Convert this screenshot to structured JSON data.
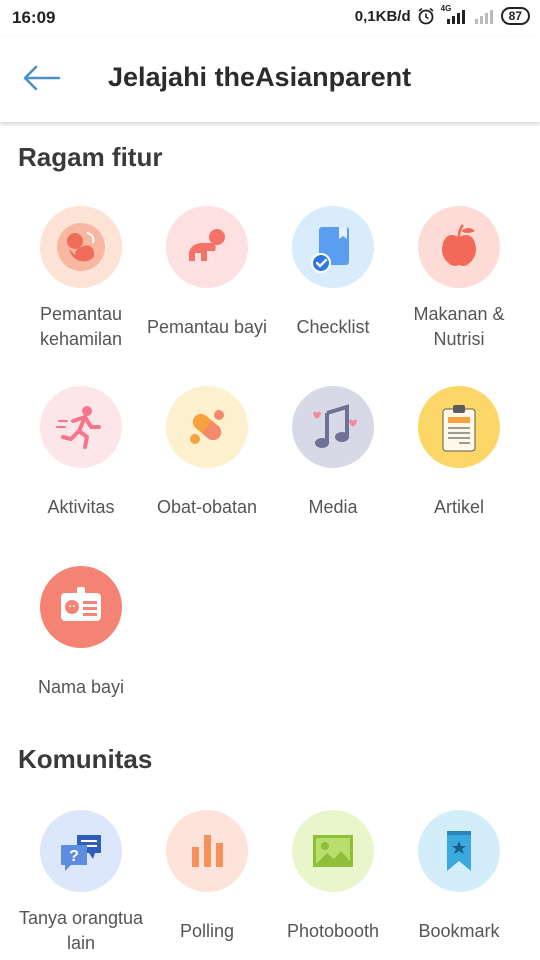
{
  "status_bar": {
    "time": "16:09",
    "network_speed": "0,1KB/d",
    "signal_label": "4G",
    "battery": "87"
  },
  "header": {
    "title": "Jelajahi theAsianparent"
  },
  "sections": {
    "features": {
      "title": "Ragam fitur",
      "items": [
        {
          "label": "Pemantau kehamilan",
          "icon": "pregnancy-icon",
          "color": "#FDE3D6"
        },
        {
          "label": "Pemantau bayi",
          "icon": "crawling-baby-icon",
          "color": "#FDE1E1"
        },
        {
          "label": "Checklist",
          "icon": "checklist-icon",
          "color": "#D8ECFB"
        },
        {
          "label": "Makanan & Nutrisi",
          "icon": "apple-icon",
          "color": "#FDDCD8"
        },
        {
          "label": "Aktivitas",
          "icon": "running-icon",
          "color": "#FDE6EA"
        },
        {
          "label": "Obat-obatan",
          "icon": "pill-icon",
          "color": "#FDF0CF"
        },
        {
          "label": "Media",
          "icon": "music-note-icon",
          "color": "#D8D9E6"
        },
        {
          "label": "Artikel",
          "icon": "clipboard-icon",
          "color": "#FCD768"
        },
        {
          "label": "Nama bayi",
          "icon": "baby-id-card-icon",
          "color": "#F58373"
        }
      ]
    },
    "community": {
      "title": "Komunitas",
      "items": [
        {
          "label": "Tanya orangtua lain",
          "icon": "chat-question-icon",
          "color": "#DCE7FB"
        },
        {
          "label": "Polling",
          "icon": "bar-chart-icon",
          "color": "#FDE3D9"
        },
        {
          "label": "Photobooth",
          "icon": "photo-icon",
          "color": "#E9F5CB"
        },
        {
          "label": "Bookmark",
          "icon": "bookmark-icon",
          "color": "#D3EEFA"
        }
      ]
    }
  }
}
